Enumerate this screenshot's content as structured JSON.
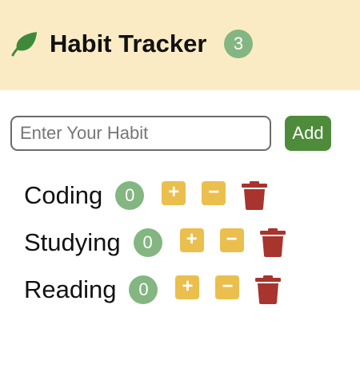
{
  "header": {
    "title": "Habit Tracker",
    "count": "3",
    "logo_icon": "leaf-icon"
  },
  "form": {
    "placeholder": "Enter Your Habit",
    "value": "",
    "add_label": "Add"
  },
  "habits": [
    {
      "name": "Coding",
      "count": "0",
      "increment": "+",
      "decrement": "−"
    },
    {
      "name": "Studying",
      "count": "0",
      "increment": "+",
      "decrement": "−"
    },
    {
      "name": "Reading",
      "count": "0",
      "increment": "+",
      "decrement": "−"
    }
  ],
  "colors": {
    "header_bg": "#fbebc5",
    "badge": "#83b680",
    "add_button": "#4e8b3a",
    "step_button": "#eabf4d",
    "delete": "#a8342e",
    "leaf": "#3f8a3a"
  }
}
